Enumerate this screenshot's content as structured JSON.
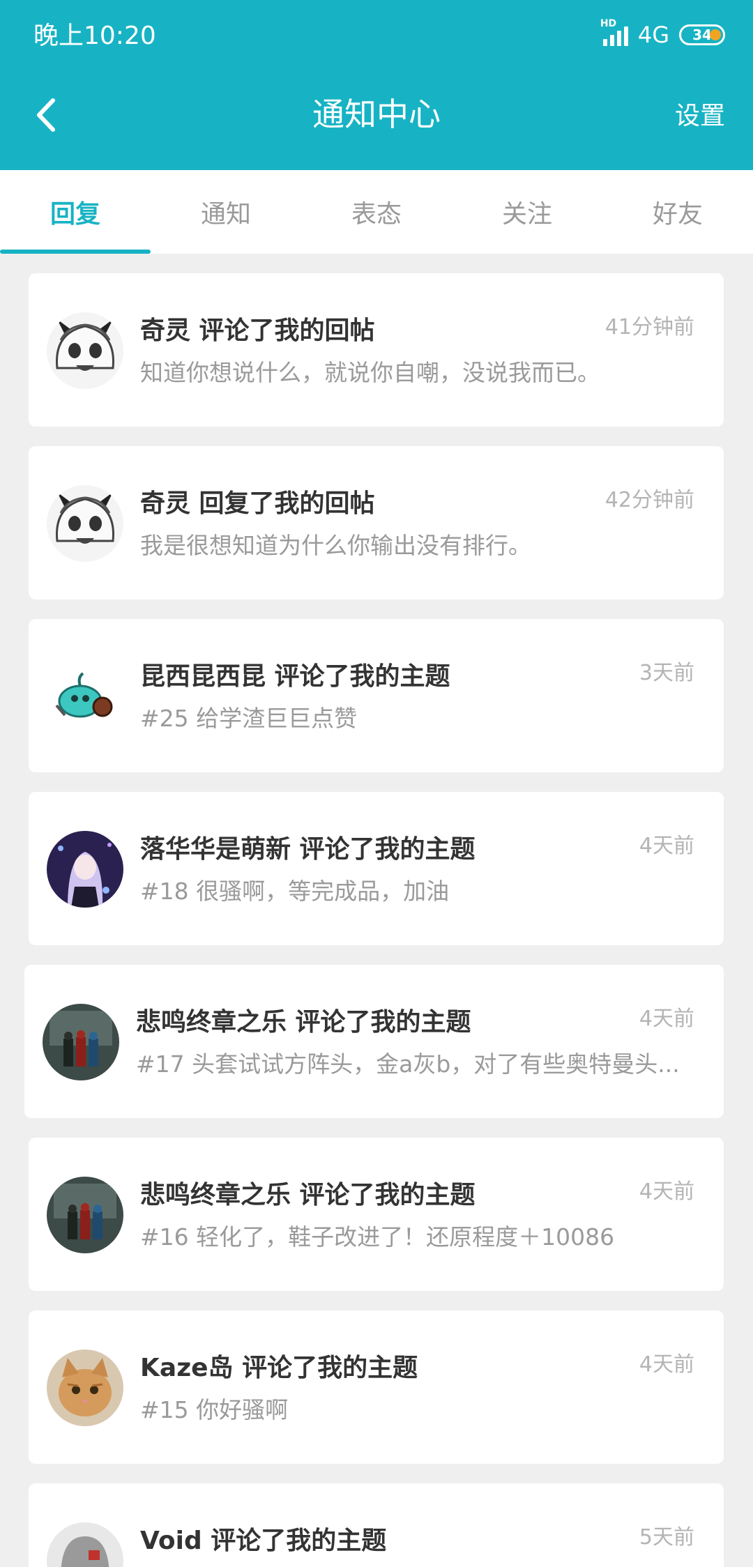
{
  "status_bar": {
    "time": "晚上10:20",
    "network": "4G",
    "hd": "HD",
    "battery": "34"
  },
  "header": {
    "title": "通知中心",
    "settings_label": "设置",
    "back_icon": "chevron-left-icon"
  },
  "tabs": [
    {
      "label": "回复",
      "active": true
    },
    {
      "label": "通知",
      "active": false
    },
    {
      "label": "表态",
      "active": false
    },
    {
      "label": "关注",
      "active": false
    },
    {
      "label": "好友",
      "active": false
    }
  ],
  "notifications": [
    {
      "title": "奇灵 评论了我的回帖",
      "time": "41分钟前",
      "body": "知道你想说什么，就说你自嘲，没说我而已。",
      "avatar": "anime-girl-horns"
    },
    {
      "title": "奇灵 回复了我的回帖",
      "time": "42分钟前",
      "body": "我是很想知道为什么你输出没有排行。",
      "avatar": "anime-girl-horns"
    },
    {
      "title": "昆西昆西昆 评论了我的主题",
      "time": "3天前",
      "body": "#25 给学渣巨巨点赞",
      "avatar": "slime-monster"
    },
    {
      "title": "落华华是萌新 评论了我的主题",
      "time": "4天前",
      "body": "#18 很骚啊，等完成品，加油",
      "avatar": "anime-girl-purple"
    },
    {
      "title": "悲鸣终章之乐 评论了我的主题",
      "time": "4天前",
      "body": "#17 头套试试方阵头，金a灰b，对了有些奥特曼头...",
      "avatar": "armored-trio"
    },
    {
      "title": "悲鸣终章之乐 评论了我的主题",
      "time": "4天前",
      "body": "#16 轻化了，鞋子改进了！还原程度＋10086",
      "avatar": "armored-trio"
    },
    {
      "title": "Kaze岛 评论了我的主题",
      "time": "4天前",
      "body": "#15 你好骚啊",
      "avatar": "cat"
    },
    {
      "title": "Void 评论了我的主题",
      "time": "5天前",
      "body": "",
      "avatar": "grey-character"
    }
  ],
  "colors": {
    "accent": "#17b3c4",
    "background": "#efefef",
    "card": "#ffffff"
  }
}
